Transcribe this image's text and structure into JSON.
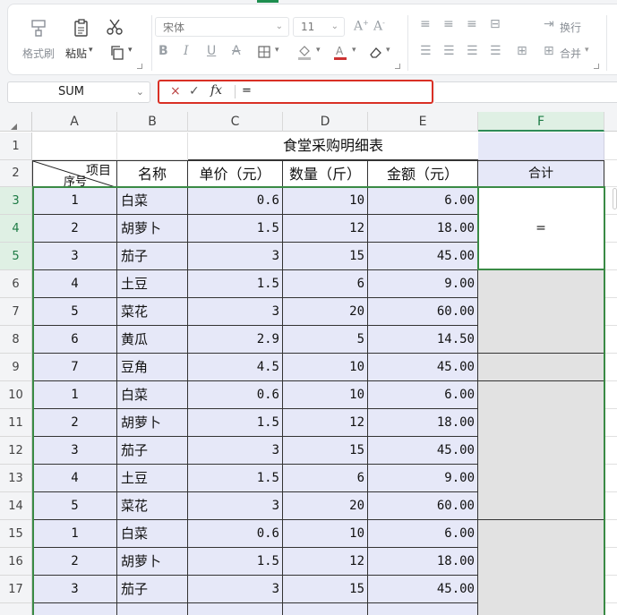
{
  "ribbon": {
    "format_painter_label": "格式刷",
    "paste_label": "粘贴",
    "font_name": "宋体",
    "font_size": "11",
    "wrap_label": "换行",
    "merge_label": "合并"
  },
  "formula_bar": {
    "name_box": "SUM",
    "cancel_glyph": "×",
    "confirm_glyph": "✓",
    "fx_label": "fx",
    "formula": "="
  },
  "columns": [
    "A",
    "B",
    "C",
    "D",
    "E",
    "F"
  ],
  "rows": [
    "1",
    "2",
    "3",
    "4",
    "5",
    "6",
    "7",
    "8",
    "9",
    "10",
    "11",
    "12",
    "13",
    "14",
    "15",
    "16",
    "17"
  ],
  "sheet": {
    "title": "食堂采购明细表",
    "header": {
      "diag_top": "项目",
      "diag_bottom": "序号",
      "name": "名称",
      "price": "单价（元）",
      "qty": "数量（斤）",
      "amount": "金额（元）",
      "total": "合计"
    },
    "data": [
      [
        "1",
        "白菜",
        "0.6",
        "10",
        "6.00"
      ],
      [
        "2",
        "胡萝卜",
        "1.5",
        "12",
        "18.00"
      ],
      [
        "3",
        "茄子",
        "3",
        "15",
        "45.00"
      ],
      [
        "4",
        "土豆",
        "1.5",
        "6",
        "9.00"
      ],
      [
        "5",
        "菜花",
        "3",
        "20",
        "60.00"
      ],
      [
        "6",
        "黄瓜",
        "2.9",
        "5",
        "14.50"
      ],
      [
        "7",
        "豆角",
        "4.5",
        "10",
        "45.00"
      ],
      [
        "1",
        "白菜",
        "0.6",
        "10",
        "6.00"
      ],
      [
        "2",
        "胡萝卜",
        "1.5",
        "12",
        "18.00"
      ],
      [
        "3",
        "茄子",
        "3",
        "15",
        "45.00"
      ],
      [
        "4",
        "土豆",
        "1.5",
        "6",
        "9.00"
      ],
      [
        "5",
        "菜花",
        "3",
        "20",
        "60.00"
      ],
      [
        "1",
        "白菜",
        "0.6",
        "10",
        "6.00"
      ],
      [
        "2",
        "胡萝卜",
        "1.5",
        "12",
        "18.00"
      ],
      [
        "3",
        "茄子",
        "3",
        "15",
        "45.00"
      ]
    ],
    "active_cell_value": "="
  },
  "colors": {
    "selection_fill": "#e6e8f8",
    "merged_fill": "#e2e2e2",
    "selection_border": "#3a8a45",
    "formula_highlight": "#d93025"
  }
}
